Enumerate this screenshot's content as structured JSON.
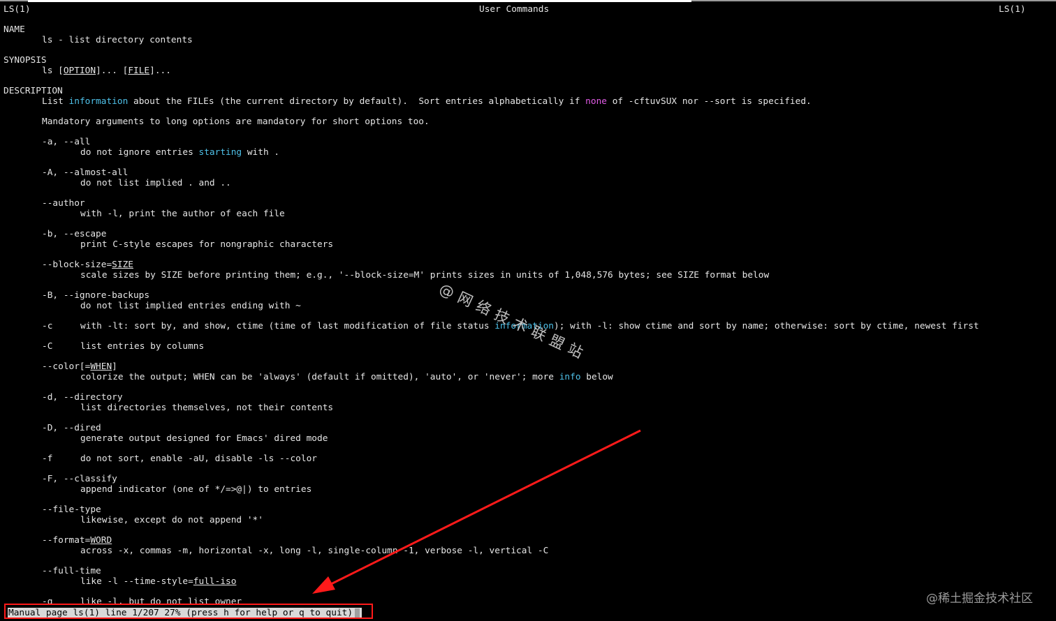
{
  "header": {
    "left": "LS(1)",
    "center": "User Commands",
    "right": "LS(1)"
  },
  "name_section": {
    "heading": "NAME",
    "text": "ls - list directory contents"
  },
  "synopsis": {
    "heading": "SYNOPSIS",
    "cmd": "ls ",
    "open1": "[",
    "opt": "OPTION",
    "mid": "]... [",
    "file": "FILE",
    "close": "]..."
  },
  "description": {
    "heading": "DESCRIPTION",
    "p1_a": "List ",
    "p1_info": "information",
    "p1_b": " about the FILEs (the current directory by default).  Sort entries alphabetically if ",
    "p1_none": "none",
    "p1_c": " of -cftuvSUX nor --sort is specified.",
    "p2": "Mandatory arguments to long options are mandatory for short options too."
  },
  "options": {
    "all_flag": "-a, --all",
    "all_desc_a": "do not ignore entries ",
    "all_desc_hl": "starting",
    "all_desc_b": " with .",
    "almost_flag": "-A, --almost-all",
    "almost_desc": "do not list implied . and ..",
    "author_flag": "--author",
    "author_desc": "with -l, print the author of each file",
    "escape_flag": "-b, --escape",
    "escape_desc": "print C-style escapes for nongraphic characters",
    "bs_flag_a": "--block-size=",
    "bs_flag_u": "SIZE",
    "bs_desc": "scale sizes by SIZE before printing them; e.g., '--block-size=M' prints sizes in units of 1,048,576 bytes; see SIZE format below",
    "ib_flag": "-B, --ignore-backups",
    "ib_desc": "do not list implied entries ending with ~",
    "c_flag": "-c",
    "c_desc_a": "with -lt: sort by, and show, ctime (time of last modification of file status ",
    "c_desc_hl": "information",
    "c_desc_b": "); with -l: show ctime and sort by name; otherwise: sort by ctime, newest first",
    "C_flag": "-C",
    "C_desc": "list entries by columns",
    "color_flag_a": "--color[=",
    "color_flag_u": "WHEN",
    "color_flag_b": "]",
    "color_desc_a": "colorize the output; WHEN can be 'always' (default if omitted), 'auto', or 'never'; more ",
    "color_desc_hl": "info",
    "color_desc_b": " below",
    "dir_flag": "-d, --directory",
    "dir_desc": "list directories themselves, not their contents",
    "dired_flag": "-D, --dired",
    "dired_desc": "generate output designed for Emacs' dired mode",
    "f_flag": "-f",
    "f_desc": "do not sort, enable -aU, disable -ls --color",
    "classify_flag": "-F, --classify",
    "classify_desc": "append indicator (one of */=>@|) to entries",
    "ft_flag": "--file-type",
    "ft_desc": "likewise, except do not append '*'",
    "fmt_flag_a": "--format=",
    "fmt_flag_u": "WORD",
    "fmt_desc": "across -x, commas -m, horizontal -x, long -l, single-column -1, verbose -l, vertical -C",
    "fullt_flag": "--full-time",
    "fullt_desc_a": "like -l --time-style=",
    "fullt_desc_u": "full-iso",
    "g_flag": "-g",
    "g_desc": "like -l, but do not list owner"
  },
  "status": {
    "text": "Manual page ls(1) line 1/207 27% (press h for help or q to quit)"
  },
  "watermarks": {
    "diag": "@网络技术联盟站",
    "corner": "@稀土掘金技术社区"
  },
  "colors": {
    "info_highlight": "#4fc1e9",
    "none_highlight": "#e25ce6",
    "annotation": "#ff1a1a"
  }
}
